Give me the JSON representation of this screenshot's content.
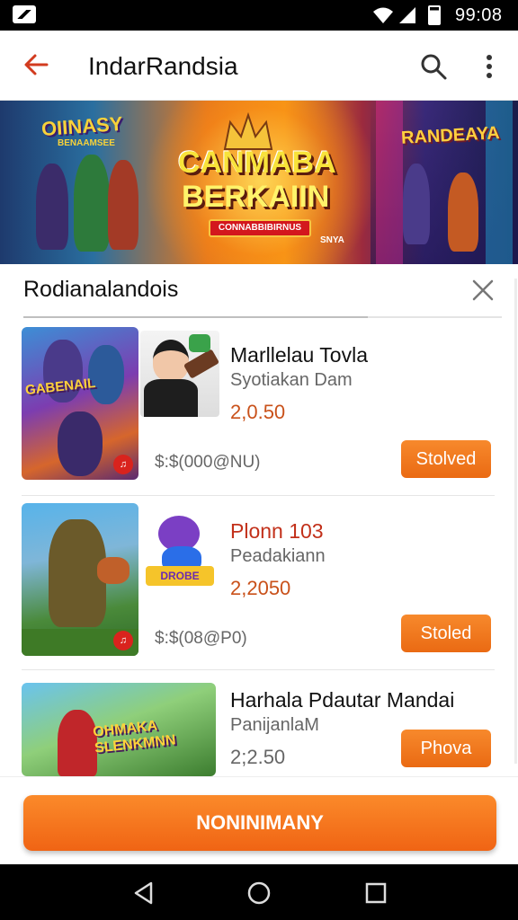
{
  "status_bar": {
    "time": "99:08",
    "icons": [
      "app-logo-icon",
      "wifi-icon",
      "signal-icon",
      "battery-icon"
    ]
  },
  "app_bar": {
    "title": "IndarRandsia",
    "back_icon": "arrow-back-icon",
    "search_icon": "search-icon",
    "more_icon": "more-vert-icon"
  },
  "banner": {
    "left_title": "OIINASY",
    "left_subtitle": "BENAAMSEE",
    "main_line1": "CANMABA",
    "main_line2": "BERKAIIN",
    "ribbon": "CONNABBIBIRNUS",
    "right_title": "RANDEAYA",
    "tag": "SNYA"
  },
  "sheet": {
    "heading": "Rodianalandois",
    "close_icon": "close-icon",
    "progress": 0.72
  },
  "items": [
    {
      "name": "Marllelau Tovla",
      "subtitle": "Syotiakan Dam",
      "price": "2,0.50",
      "small_price": "$:$(000@NU)",
      "button": "Stolved",
      "thumb_title": "GABENAIL"
    },
    {
      "name": "Plonn 103",
      "subtitle": "Peadakiann",
      "price": "2,2050",
      "small_price": "$:$(08@P0)",
      "button": "Stoled",
      "thumb_title": ""
    },
    {
      "name": "Harhala Pdautar Mandai",
      "subtitle": "PanijanlaM",
      "price": "2;2.50",
      "small_price": "",
      "button": "Phova",
      "thumb_title": "OHMAKA SLENKMNN"
    }
  ],
  "mini_labels": [
    "",
    "DROBE",
    ""
  ],
  "cta": {
    "label": "NONINIMANY"
  },
  "nav_bar": {
    "icons": [
      "back-triangle-icon",
      "home-circle-icon",
      "recents-square-icon"
    ]
  },
  "colors": {
    "accent": "#f06414",
    "price": "#c9511a",
    "status_bg": "#000000"
  }
}
